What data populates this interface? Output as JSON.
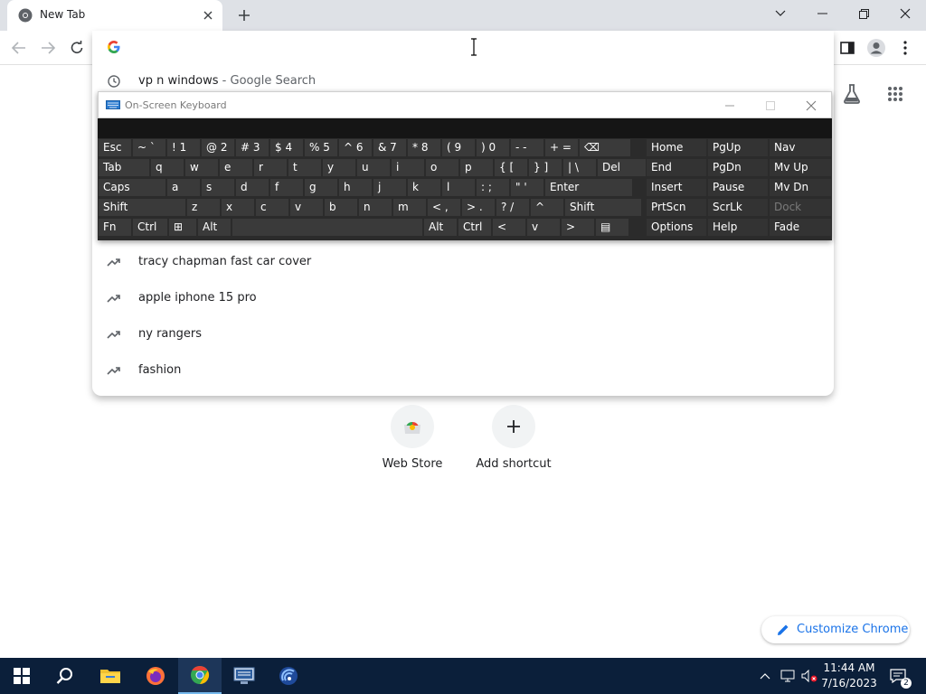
{
  "browser": {
    "tab": {
      "title": "New Tab",
      "icon": "chrome-icon"
    },
    "window_controls": [
      "chevron-down-icon",
      "minimize-icon",
      "restore-icon",
      "close-icon"
    ]
  },
  "omnibox": {
    "input_value": "",
    "suggestions": [
      {
        "icon": "history-icon",
        "text": "vp n windows",
        "suffix": " - Google Search"
      },
      {
        "icon": "trending-icon",
        "text": "tracy chapman fast car cover"
      },
      {
        "icon": "trending-icon",
        "text": "apple iphone 15 pro"
      },
      {
        "icon": "trending-icon",
        "text": "ny rangers"
      },
      {
        "icon": "trending-icon",
        "text": "fashion"
      }
    ]
  },
  "new_tab_page": {
    "shortcuts": [
      {
        "label": "Web Store",
        "icon": "web-store-icon"
      },
      {
        "label": "Add shortcut",
        "icon": "plus-icon"
      }
    ],
    "customize_label": "Customize Chrome"
  },
  "osk": {
    "title": "On-Screen Keyboard",
    "rows": [
      [
        "Esc",
        "~ `",
        "! 1",
        "@ 2",
        "# 3",
        "$ 4",
        "% 5",
        "^ 6",
        "& 7",
        "* 8",
        "( 9",
        ") 0",
        "- -",
        "+ =",
        "⌫"
      ],
      [
        "Tab",
        "q",
        "w",
        "e",
        "r",
        "t",
        "y",
        "u",
        "i",
        "o",
        "p",
        "{ [",
        "} ]",
        "| \\",
        "Del"
      ],
      [
        "Caps",
        "a",
        "s",
        "d",
        "f",
        "g",
        "h",
        "j",
        "k",
        "l",
        ": ;",
        "\" '",
        "Enter"
      ],
      [
        "Shift",
        "z",
        "x",
        "c",
        "v",
        "b",
        "n",
        "m",
        "< ,",
        "> .",
        "? /",
        "^",
        "Shift"
      ],
      [
        "Fn",
        "Ctrl",
        "⊞",
        "Alt",
        "",
        "Alt",
        "Ctrl",
        "<",
        "v",
        ">",
        "▤"
      ]
    ],
    "side_rows": [
      [
        "Home",
        "PgUp",
        "Nav"
      ],
      [
        "End",
        "PgDn",
        "Mv Up"
      ],
      [
        "Insert",
        "Pause",
        "Mv Dn"
      ],
      [
        "PrtScn",
        "ScrLk",
        "Dock"
      ],
      [
        "Options",
        "Help",
        "Fade"
      ]
    ]
  },
  "taskbar": {
    "apps": [
      "windows-start-icon",
      "search-icon",
      "file-explorer-icon",
      "firefox-icon",
      "chrome-icon",
      "network-app-icon",
      "remote-app-icon"
    ],
    "clock_time": "11:44 AM",
    "clock_date": "7/16/2023",
    "notification_count": "2"
  },
  "colors": {
    "taskbar_bg": "#0b1f3a",
    "osk_bg": "#2b2b2b",
    "osk_key": "#3a3a3a",
    "link_blue": "#1a73e8",
    "tabstrip_bg": "#dee1e6"
  }
}
